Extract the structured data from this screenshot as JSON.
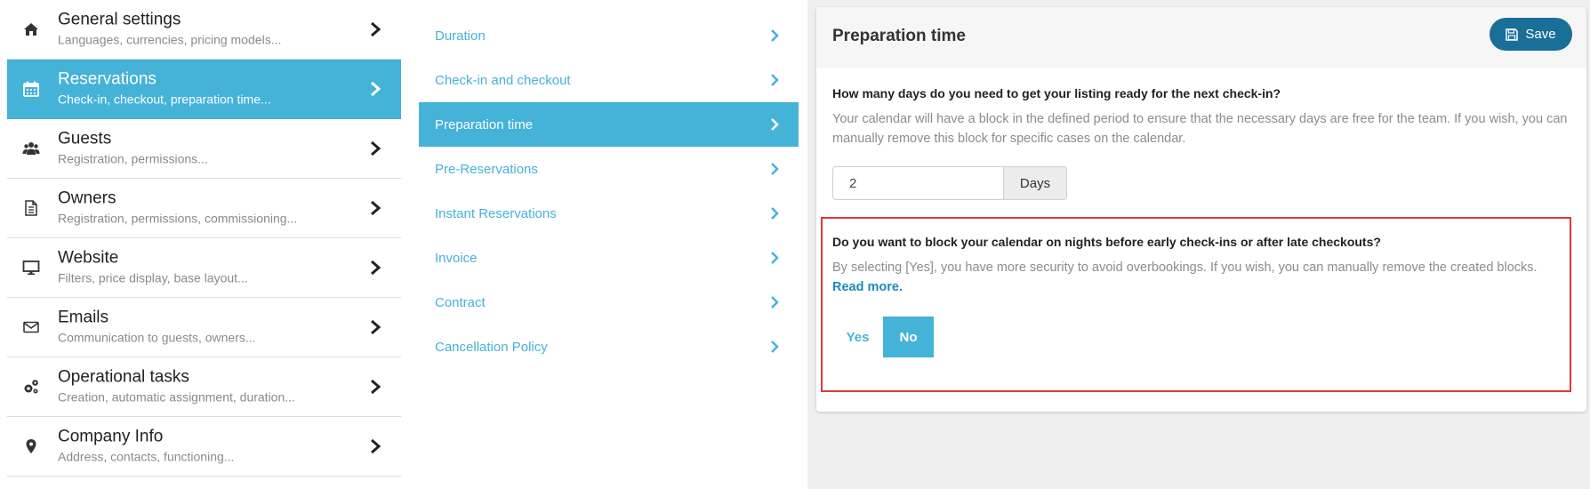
{
  "left_menu": [
    {
      "title": "General settings",
      "subtitle": "Languages, currencies, pricing models...",
      "icon": "home-icon",
      "active": false
    },
    {
      "title": "Reservations",
      "subtitle": "Check-in, checkout, preparation time...",
      "icon": "calendar-icon",
      "active": true
    },
    {
      "title": "Guests",
      "subtitle": "Registration, permissions...",
      "icon": "users-icon",
      "active": false
    },
    {
      "title": "Owners",
      "subtitle": "Registration, permissions, commissioning...",
      "icon": "document-icon",
      "active": false
    },
    {
      "title": "Website",
      "subtitle": "Filters, price display, base layout...",
      "icon": "monitor-icon",
      "active": false
    },
    {
      "title": "Emails",
      "subtitle": "Communication to guests, owners...",
      "icon": "envelope-icon",
      "active": false
    },
    {
      "title": "Operational tasks",
      "subtitle": "Creation, automatic assignment, duration...",
      "icon": "gears-icon",
      "active": false
    },
    {
      "title": "Company Info",
      "subtitle": "Address, contacts, functioning...",
      "icon": "map-pin-icon",
      "active": false
    }
  ],
  "sub_menu": [
    {
      "label": "Duration",
      "active": false
    },
    {
      "label": "Check-in and checkout",
      "active": false
    },
    {
      "label": "Preparation time",
      "active": true
    },
    {
      "label": "Pre-Reservations",
      "active": false
    },
    {
      "label": "Instant Reservations",
      "active": false
    },
    {
      "label": "Invoice",
      "active": false
    },
    {
      "label": "Contract",
      "active": false
    },
    {
      "label": "Cancellation Policy",
      "active": false
    }
  ],
  "panel": {
    "title": "Preparation time",
    "save_label": "Save",
    "question1": "How many days do you need to get your listing ready for the next check-in?",
    "description1": "Your calendar will have a block in the defined period to ensure that the necessary days are free for the team. If you wish, you can manually remove this block for specific cases on the calendar.",
    "days_value": "2",
    "days_unit": "Days",
    "question2": "Do you want to block your calendar on nights before early check-ins or after late checkouts?",
    "description2": "By selecting [Yes], you have more security to avoid overbookings. If you wish, you can manually remove the created blocks.",
    "read_more": "Read more.",
    "toggle_yes": "Yes",
    "toggle_no": "No",
    "toggle_selected": "No"
  },
  "colors": {
    "accent": "#45b2d8",
    "save_button": "#1a6f99",
    "highlight_border": "#e0373b"
  }
}
